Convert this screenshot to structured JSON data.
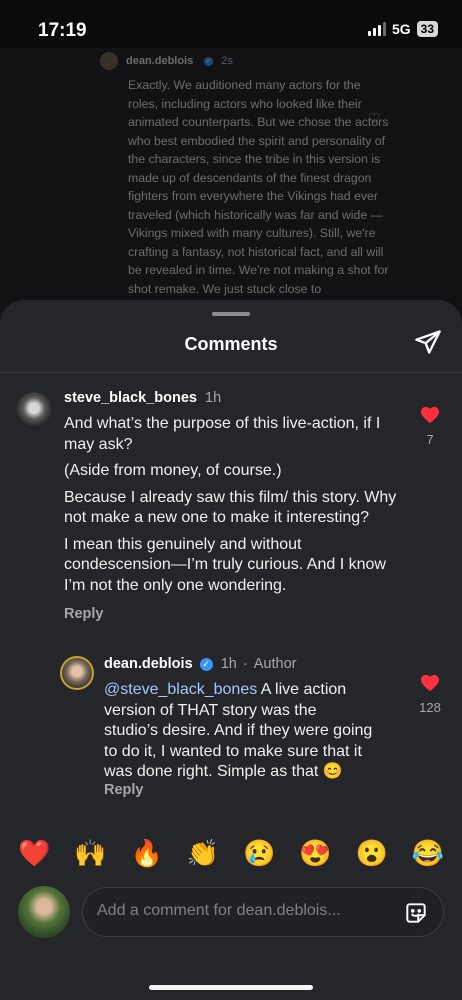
{
  "status": {
    "time": "17:19",
    "network": "5G",
    "battery": "33"
  },
  "background_post": {
    "username": "dean.deblois",
    "time": "2s",
    "text": "Exactly. We auditioned many actors for the roles, including actors who looked like their animated counterparts. But we chose the actors who best embodied the spirit and personality of the characters, since the tribe in this version is made up of descendants of the finest dragon fighters from everywhere the Vikings had ever traveled (which historically was far and wide — Vikings mixed with many cultures). Still, we're crafting a fantasy, not historical fact, and all will be revealed in time. We're not making a shot for shot remake. We just stuck close to"
  },
  "sheet": {
    "title": "Comments"
  },
  "comments": [
    {
      "username": "steve_black_bones",
      "time": "1h",
      "paragraphs": [
        "And what’s the purpose of this live-action, if I may ask?",
        "(Aside from money, of course.)",
        "Because I already saw this film/ this story. Why not make a new one to make it interesting?",
        "I mean this genuinely and without condescension—I’m truly curious. And I know I’m not the only one wondering."
      ],
      "reply_label": "Reply",
      "likes": "7"
    },
    {
      "username": "dean.deblois",
      "time": "1h",
      "author_label": "Author",
      "mention": "@steve_black_bones",
      "text": " A live action version of THAT story was the studio’s desire. And if they were going to do it, I wanted to make sure that it was done right. Simple as that 😊",
      "reply_label": "Reply",
      "likes": "128"
    }
  ],
  "reactions": [
    "❤️",
    "🙌",
    "🔥",
    "👏",
    "😢",
    "😍",
    "😮",
    "😂"
  ],
  "input": {
    "placeholder": "Add a comment for dean.deblois..."
  },
  "colors": {
    "sheet_bg": "#242629",
    "like_red": "#ff3040",
    "mention": "#a9c6ff",
    "verified": "#3897f0"
  }
}
